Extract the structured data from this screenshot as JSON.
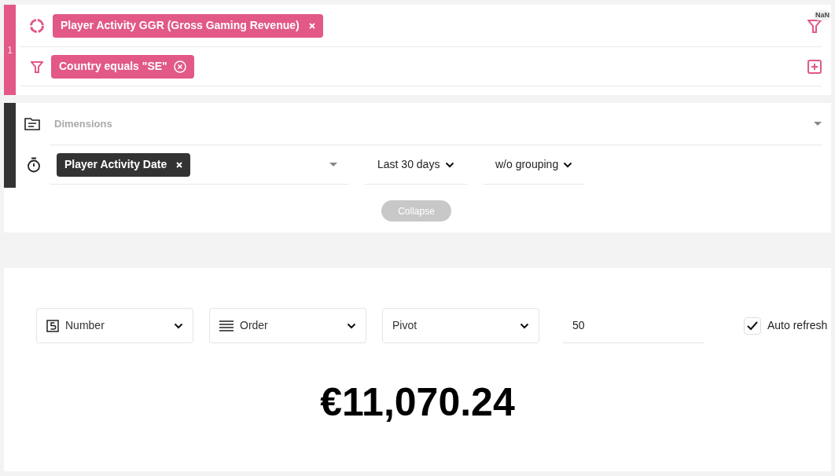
{
  "query": {
    "index": "1",
    "badge": "NaN",
    "measures": [
      {
        "label": "Player Activity GGR (Gross Gaming Revenue)"
      }
    ],
    "filters": [
      {
        "label": "Country equals \"SE\""
      }
    ]
  },
  "dimensions": {
    "placeholder": "Dimensions",
    "time_dimension": "Player Activity Date",
    "date_range": "Last 30 days",
    "granularity": "w/o grouping",
    "collapse": "Collapse"
  },
  "toolbar": {
    "chart_type": "Number",
    "order": "Order",
    "pivot": "Pivot",
    "limit": "50",
    "auto_refresh": {
      "label": "Auto refresh",
      "checked": true
    }
  },
  "result": "€11,070.24"
}
